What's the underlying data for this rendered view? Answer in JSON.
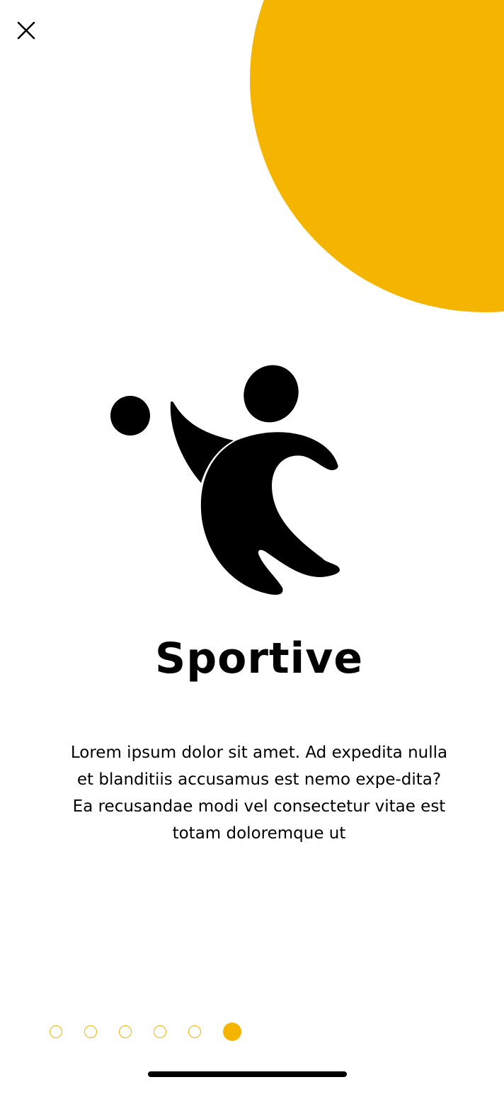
{
  "colors": {
    "accent": "#F4B400",
    "text": "#000000",
    "background": "#FFFFFF"
  },
  "close_button": {
    "icon": "close-icon"
  },
  "logo": {
    "icon": "athlete-with-ball-logo"
  },
  "onboarding": {
    "title": "Sportive",
    "description": "Lorem ipsum dolor sit amet. Ad expedita nulla et blanditiis accusamus est nemo expe-dita? Ea recusandae modi vel consectetur vitae est totam doloremque ut"
  },
  "pager": {
    "total_pages": 6,
    "current_page": 6
  }
}
